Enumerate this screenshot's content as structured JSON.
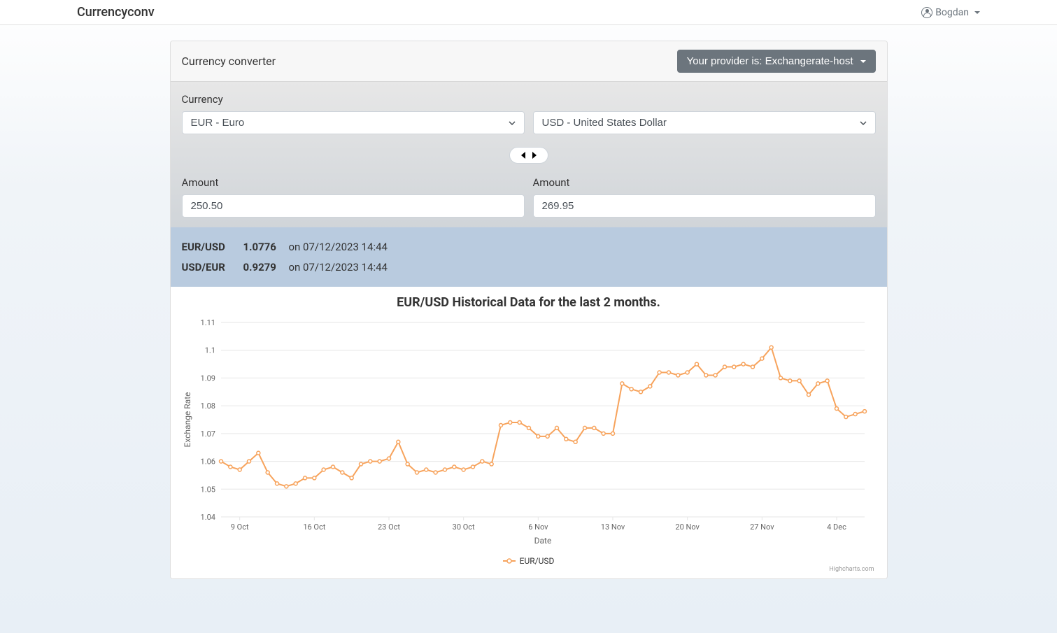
{
  "nav": {
    "brand": "Currencyconv",
    "user": "Bogdan"
  },
  "card": {
    "title": "Currency converter",
    "provider_button": "Your provider is: Exchangerate-host"
  },
  "converter": {
    "currency_label": "Currency",
    "from_currency": "EUR - Euro",
    "to_currency": "USD - United States Dollar",
    "amount_label_from": "Amount",
    "amount_label_to": "Amount",
    "amount_from": "250.50",
    "amount_to": "269.95"
  },
  "rates": [
    {
      "pair": "EUR/USD",
      "value": "1.0776",
      "date_text": "on 07/12/2023 14:44"
    },
    {
      "pair": "USD/EUR",
      "value": "0.9279",
      "date_text": "on 07/12/2023 14:44"
    }
  ],
  "chart_data": {
    "type": "line",
    "title": "EUR/USD Historical Data for the last 2 months.",
    "xlabel": "Date",
    "ylabel": "Exchange Rate",
    "ylim": [
      1.04,
      1.11
    ],
    "yticks": [
      1.04,
      1.05,
      1.06,
      1.07,
      1.08,
      1.09,
      1.1,
      1.11
    ],
    "xticks": [
      "9 Oct",
      "16 Oct",
      "23 Oct",
      "30 Oct",
      "6 Nov",
      "13 Nov",
      "20 Nov",
      "27 Nov",
      "4 Dec"
    ],
    "series": [
      {
        "name": "EUR/USD",
        "values": [
          1.06,
          1.058,
          1.057,
          1.06,
          1.063,
          1.056,
          1.052,
          1.051,
          1.052,
          1.054,
          1.054,
          1.057,
          1.058,
          1.056,
          1.054,
          1.059,
          1.06,
          1.06,
          1.061,
          1.067,
          1.059,
          1.056,
          1.057,
          1.056,
          1.057,
          1.058,
          1.057,
          1.058,
          1.06,
          1.059,
          1.073,
          1.074,
          1.074,
          1.072,
          1.069,
          1.069,
          1.072,
          1.068,
          1.067,
          1.072,
          1.072,
          1.07,
          1.07,
          1.088,
          1.086,
          1.085,
          1.087,
          1.092,
          1.092,
          1.091,
          1.092,
          1.095,
          1.091,
          1.091,
          1.094,
          1.094,
          1.095,
          1.094,
          1.097,
          1.101,
          1.09,
          1.089,
          1.089,
          1.084,
          1.088,
          1.089,
          1.079,
          1.076,
          1.077,
          1.078
        ]
      }
    ],
    "credit": "Highcharts.com"
  }
}
